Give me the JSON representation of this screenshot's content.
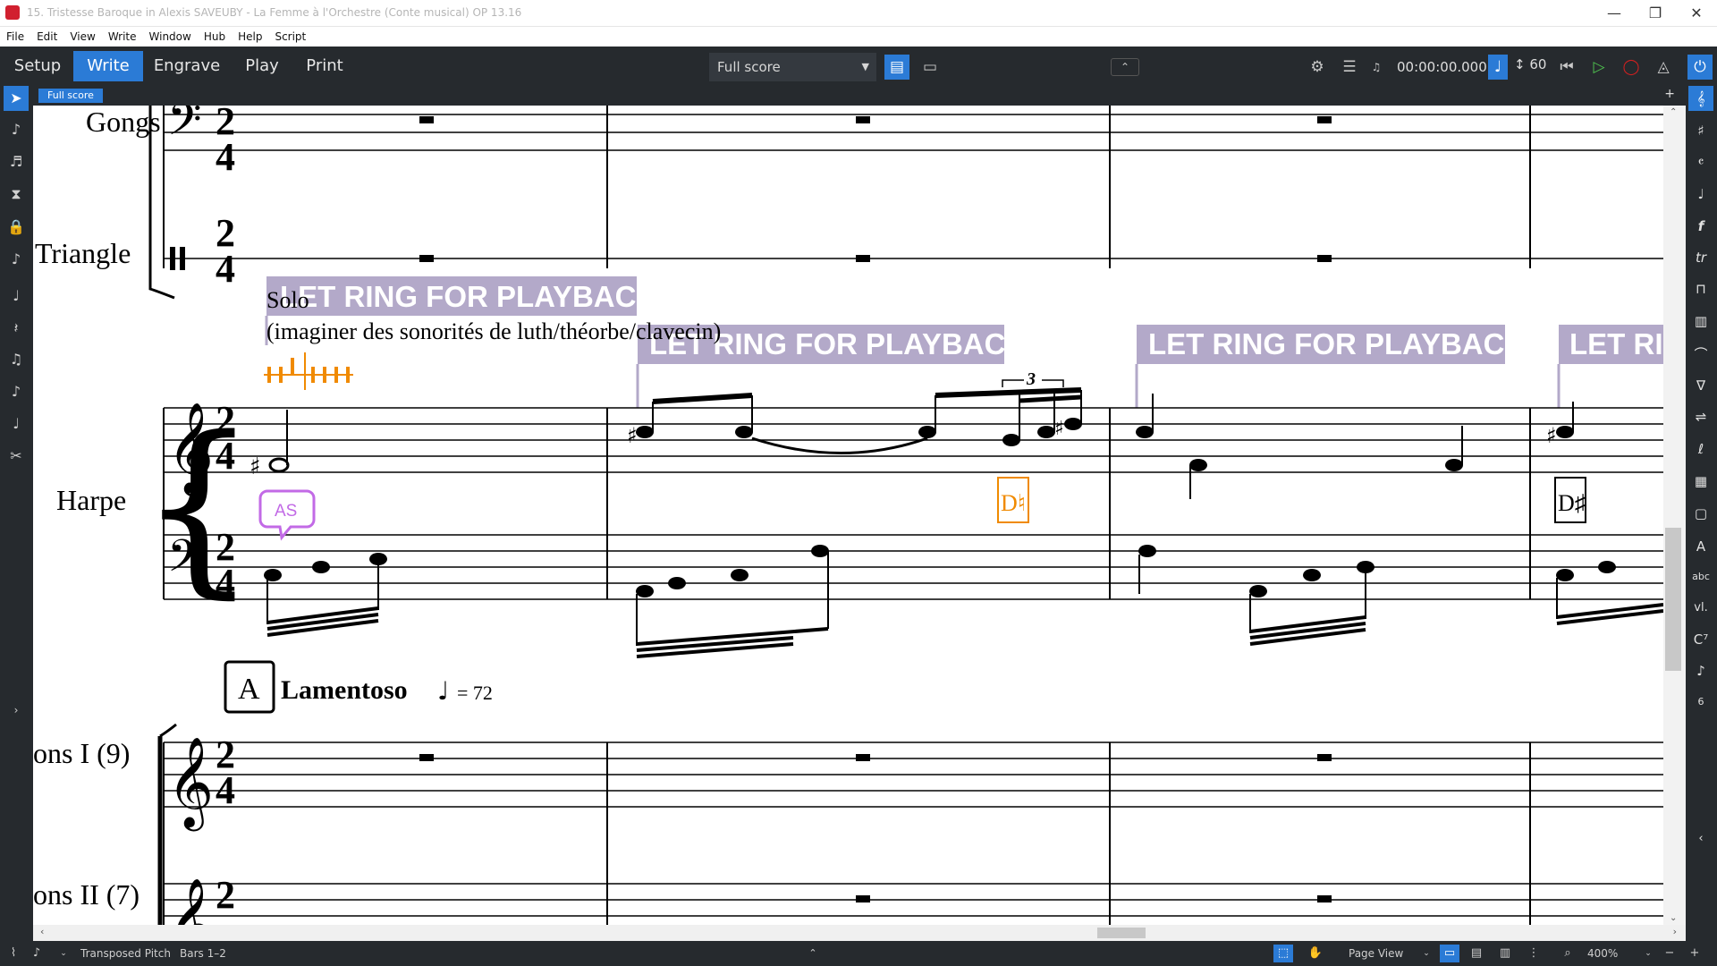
{
  "window": {
    "title": "15. Tristesse Baroque in Alexis SAVEUBY - La Femme à l'Orchestre (Conte musical) OP 13.16",
    "minimize": "—",
    "restore": "❐",
    "close": "✕"
  },
  "menu": [
    "File",
    "Edit",
    "View",
    "Write",
    "Window",
    "Hub",
    "Help",
    "Script"
  ],
  "modes": [
    "Setup",
    "Write",
    "Engrave",
    "Play",
    "Print"
  ],
  "active_mode": "Write",
  "layout_select": {
    "value": "Full score"
  },
  "transport": {
    "timecode": "00:00:00.000",
    "tempo": "60"
  },
  "score_tab": "Full score",
  "instruments": {
    "gongs": "Gongs",
    "triangle": "Triangle",
    "harp": "Harpe",
    "violins1": "ons I (9)",
    "violins2": "ons II (7)"
  },
  "texts": {
    "let_ring_1": "LET RING FOR PLAYBACK",
    "let_ring_2": "LET RING FOR PLAYBACK",
    "let_ring_3": "LET RING FOR PLAYBACK",
    "let_ring_4": "LET RI",
    "solo": "Solo",
    "expression": "(imaginer des sonorités de luth/théorbe/clavecin)",
    "time_sig": "2",
    "time_sig_den": "4",
    "triplet": "3",
    "pedal_orange": "D♮",
    "pedal_black": "D♯",
    "comment_initials": "AS",
    "rehearsal_mark": "A",
    "tempo_text": "Lamentoso",
    "tempo_mark": "= 72"
  },
  "colors": {
    "chrome": "#262a2e",
    "accent": "#2b7bd6",
    "let_ring_bg": "#b3a9c9",
    "orange": "#f08a00",
    "comment": "#c26ae6"
  },
  "status": {
    "pitch": "Transposed Pitch",
    "bars": "Bars 1–2",
    "view": "Page View",
    "zoom": "400%"
  }
}
